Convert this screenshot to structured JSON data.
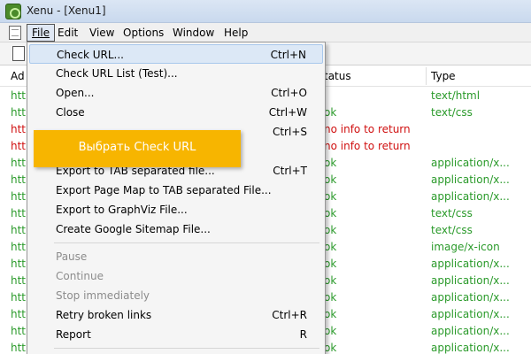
{
  "window": {
    "title": "Xenu - [Xenu1]"
  },
  "menubar": {
    "items": [
      {
        "label": "File",
        "active": true
      },
      {
        "label": "Edit"
      },
      {
        "label": "View"
      },
      {
        "label": "Options"
      },
      {
        "label": "Window"
      },
      {
        "label": "Help"
      }
    ]
  },
  "table": {
    "columns": {
      "address": "Ad",
      "status": "tatus",
      "type": "Type"
    },
    "rows": [
      {
        "address": "htt",
        "status": "",
        "type": "text/html",
        "color": "green"
      },
      {
        "address": "htt",
        "status": "ok",
        "type": "text/css",
        "color": "green"
      },
      {
        "address": "htt",
        "status": "no info to return",
        "type": "",
        "color": "red"
      },
      {
        "address": "htt",
        "status": "no info to return",
        "type": "",
        "color": "red"
      },
      {
        "address": "htt",
        "status": "ok",
        "type": "application/x...",
        "color": "green"
      },
      {
        "address": "htt",
        "status": "ok",
        "type": "application/x...",
        "color": "green"
      },
      {
        "address": "htt",
        "status": "ok",
        "type": "application/x...",
        "color": "green"
      },
      {
        "address": "htt",
        "status": "ok",
        "type": "text/css",
        "color": "green"
      },
      {
        "address": "htt",
        "status": "ok",
        "type": "text/css",
        "color": "green"
      },
      {
        "address": "htt",
        "status": "ok",
        "type": "image/x-icon",
        "color": "green"
      },
      {
        "address": "htt",
        "status": "ok",
        "type": "application/x...",
        "color": "green"
      },
      {
        "address": "htt",
        "status": "ok",
        "type": "application/x...",
        "color": "green"
      },
      {
        "address": "htt",
        "status": "ok",
        "type": "application/x...",
        "color": "green"
      },
      {
        "address": "htt",
        "status": "ok",
        "type": "application/x...",
        "color": "green"
      },
      {
        "address": "htt",
        "status": "ok",
        "type": "application/x...",
        "color": "green"
      },
      {
        "address": "htt",
        "status": "ok",
        "type": "application/x...",
        "color": "green"
      }
    ]
  },
  "file_menu": {
    "items": [
      {
        "label": "Check URL...",
        "shortcut": "Ctrl+N",
        "highlight": true
      },
      {
        "label": "Check URL List (Test)...",
        "shortcut": ""
      },
      {
        "label": "Open...",
        "shortcut": "Ctrl+O"
      },
      {
        "label": "Close",
        "shortcut": "Ctrl+W"
      },
      {
        "label": "",
        "shortcut": "Ctrl+S"
      },
      {
        "label": "",
        "shortcut": ""
      },
      {
        "label": "Export to TAB separated file...",
        "shortcut": "Ctrl+T"
      },
      {
        "label": "Export Page Map to TAB separated File...",
        "shortcut": ""
      },
      {
        "label": "Export to GraphViz File...",
        "shortcut": ""
      },
      {
        "label": "Create Google Sitemap File...",
        "shortcut": ""
      },
      {
        "separator": true
      },
      {
        "label": "Pause",
        "shortcut": "",
        "disabled": true
      },
      {
        "label": "Continue",
        "shortcut": "",
        "disabled": true
      },
      {
        "label": "Stop immediately",
        "shortcut": "",
        "disabled": true
      },
      {
        "label": "Retry broken links",
        "shortcut": "Ctrl+R"
      },
      {
        "label": "Report",
        "shortcut": "R"
      },
      {
        "separator": true
      }
    ]
  },
  "callout": {
    "text": "Выбрать Check URL"
  },
  "colors": {
    "ok": "#2a9a2a",
    "error": "#d01010",
    "callout": "#f7b500",
    "highlight": "#dce8f6"
  }
}
